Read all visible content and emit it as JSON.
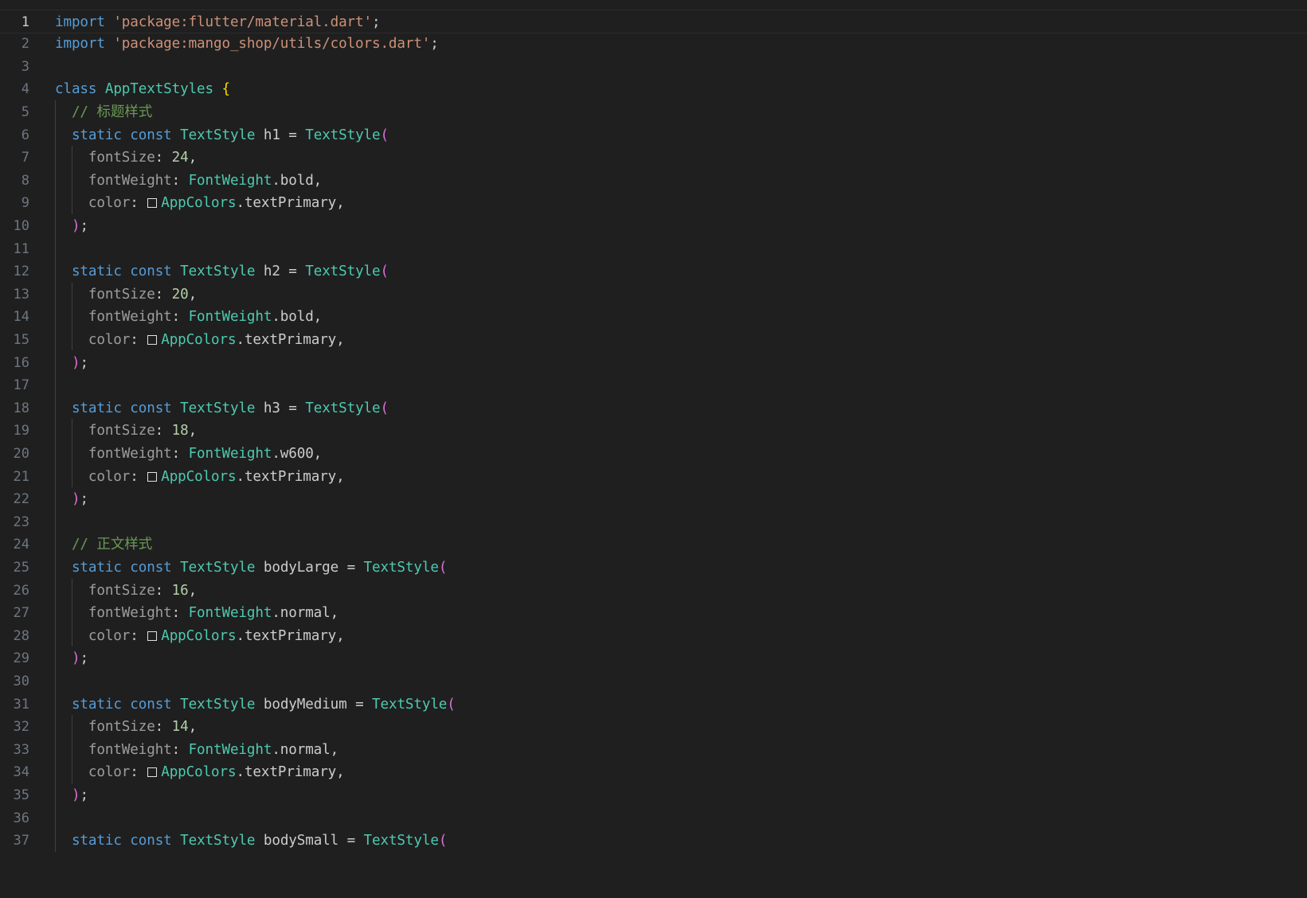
{
  "editor": {
    "language": "dart",
    "active_line": 1,
    "swatch_color": "#1f1f1f",
    "lines": [
      {
        "n": "1",
        "tokens": [
          {
            "t": "import",
            "c": "kw"
          },
          {
            "t": " ",
            "c": "pl"
          },
          {
            "t": "'package:flutter/material.dart'",
            "c": "str"
          },
          {
            "t": ";",
            "c": "pl"
          }
        ]
      },
      {
        "n": "2",
        "tokens": [
          {
            "t": "import",
            "c": "kw"
          },
          {
            "t": " ",
            "c": "pl"
          },
          {
            "t": "'package:mango_shop/utils/colors.dart'",
            "c": "str"
          },
          {
            "t": ";",
            "c": "pl"
          }
        ]
      },
      {
        "n": "3",
        "tokens": []
      },
      {
        "n": "4",
        "tokens": [
          {
            "t": "class",
            "c": "kw"
          },
          {
            "t": " ",
            "c": "pl"
          },
          {
            "t": "AppTextStyles",
            "c": "type"
          },
          {
            "t": " ",
            "c": "pl"
          },
          {
            "t": "{",
            "c": "br1"
          }
        ]
      },
      {
        "n": "5",
        "tokens": [
          {
            "t": "  // 标题样式",
            "c": "com"
          }
        ]
      },
      {
        "n": "6",
        "tokens": [
          {
            "t": "  ",
            "c": "pl"
          },
          {
            "t": "static",
            "c": "kw"
          },
          {
            "t": " ",
            "c": "pl"
          },
          {
            "t": "const",
            "c": "kw"
          },
          {
            "t": " ",
            "c": "pl"
          },
          {
            "t": "TextStyle",
            "c": "type"
          },
          {
            "t": " h1 = ",
            "c": "pl"
          },
          {
            "t": "TextStyle",
            "c": "type"
          },
          {
            "t": "(",
            "c": "br2"
          }
        ]
      },
      {
        "n": "7",
        "tokens": [
          {
            "t": "    ",
            "c": "pl"
          },
          {
            "t": "fontSize",
            "c": "param"
          },
          {
            "t": ": ",
            "c": "pl"
          },
          {
            "t": "24",
            "c": "num"
          },
          {
            "t": ",",
            "c": "pl"
          }
        ]
      },
      {
        "n": "8",
        "tokens": [
          {
            "t": "    ",
            "c": "pl"
          },
          {
            "t": "fontWeight",
            "c": "param"
          },
          {
            "t": ": ",
            "c": "pl"
          },
          {
            "t": "FontWeight",
            "c": "type"
          },
          {
            "t": ".bold,",
            "c": "pl"
          }
        ]
      },
      {
        "n": "9",
        "tokens": [
          {
            "t": "    ",
            "c": "pl"
          },
          {
            "t": "color",
            "c": "param"
          },
          {
            "t": ": ",
            "c": "pl"
          },
          {
            "t": "",
            "c": "swatch"
          },
          {
            "t": "AppColors",
            "c": "type"
          },
          {
            "t": ".textPrimary,",
            "c": "pl"
          }
        ]
      },
      {
        "n": "10",
        "tokens": [
          {
            "t": "  ",
            "c": "pl"
          },
          {
            "t": ")",
            "c": "br2"
          },
          {
            "t": ";",
            "c": "pl"
          }
        ]
      },
      {
        "n": "11",
        "tokens": []
      },
      {
        "n": "12",
        "tokens": [
          {
            "t": "  ",
            "c": "pl"
          },
          {
            "t": "static",
            "c": "kw"
          },
          {
            "t": " ",
            "c": "pl"
          },
          {
            "t": "const",
            "c": "kw"
          },
          {
            "t": " ",
            "c": "pl"
          },
          {
            "t": "TextStyle",
            "c": "type"
          },
          {
            "t": " h2 = ",
            "c": "pl"
          },
          {
            "t": "TextStyle",
            "c": "type"
          },
          {
            "t": "(",
            "c": "br2"
          }
        ]
      },
      {
        "n": "13",
        "tokens": [
          {
            "t": "    ",
            "c": "pl"
          },
          {
            "t": "fontSize",
            "c": "param"
          },
          {
            "t": ": ",
            "c": "pl"
          },
          {
            "t": "20",
            "c": "num"
          },
          {
            "t": ",",
            "c": "pl"
          }
        ]
      },
      {
        "n": "14",
        "tokens": [
          {
            "t": "    ",
            "c": "pl"
          },
          {
            "t": "fontWeight",
            "c": "param"
          },
          {
            "t": ": ",
            "c": "pl"
          },
          {
            "t": "FontWeight",
            "c": "type"
          },
          {
            "t": ".bold,",
            "c": "pl"
          }
        ]
      },
      {
        "n": "15",
        "tokens": [
          {
            "t": "    ",
            "c": "pl"
          },
          {
            "t": "color",
            "c": "param"
          },
          {
            "t": ": ",
            "c": "pl"
          },
          {
            "t": "",
            "c": "swatch"
          },
          {
            "t": "AppColors",
            "c": "type"
          },
          {
            "t": ".textPrimary,",
            "c": "pl"
          }
        ]
      },
      {
        "n": "16",
        "tokens": [
          {
            "t": "  ",
            "c": "pl"
          },
          {
            "t": ")",
            "c": "br2"
          },
          {
            "t": ";",
            "c": "pl"
          }
        ]
      },
      {
        "n": "17",
        "tokens": []
      },
      {
        "n": "18",
        "tokens": [
          {
            "t": "  ",
            "c": "pl"
          },
          {
            "t": "static",
            "c": "kw"
          },
          {
            "t": " ",
            "c": "pl"
          },
          {
            "t": "const",
            "c": "kw"
          },
          {
            "t": " ",
            "c": "pl"
          },
          {
            "t": "TextStyle",
            "c": "type"
          },
          {
            "t": " h3 = ",
            "c": "pl"
          },
          {
            "t": "TextStyle",
            "c": "type"
          },
          {
            "t": "(",
            "c": "br2"
          }
        ]
      },
      {
        "n": "19",
        "tokens": [
          {
            "t": "    ",
            "c": "pl"
          },
          {
            "t": "fontSize",
            "c": "param"
          },
          {
            "t": ": ",
            "c": "pl"
          },
          {
            "t": "18",
            "c": "num"
          },
          {
            "t": ",",
            "c": "pl"
          }
        ]
      },
      {
        "n": "20",
        "tokens": [
          {
            "t": "    ",
            "c": "pl"
          },
          {
            "t": "fontWeight",
            "c": "param"
          },
          {
            "t": ": ",
            "c": "pl"
          },
          {
            "t": "FontWeight",
            "c": "type"
          },
          {
            "t": ".w600,",
            "c": "pl"
          }
        ]
      },
      {
        "n": "21",
        "tokens": [
          {
            "t": "    ",
            "c": "pl"
          },
          {
            "t": "color",
            "c": "param"
          },
          {
            "t": ": ",
            "c": "pl"
          },
          {
            "t": "",
            "c": "swatch"
          },
          {
            "t": "AppColors",
            "c": "type"
          },
          {
            "t": ".textPrimary,",
            "c": "pl"
          }
        ]
      },
      {
        "n": "22",
        "tokens": [
          {
            "t": "  ",
            "c": "pl"
          },
          {
            "t": ")",
            "c": "br2"
          },
          {
            "t": ";",
            "c": "pl"
          }
        ]
      },
      {
        "n": "23",
        "tokens": []
      },
      {
        "n": "24",
        "tokens": [
          {
            "t": "  // 正文样式",
            "c": "com"
          }
        ]
      },
      {
        "n": "25",
        "tokens": [
          {
            "t": "  ",
            "c": "pl"
          },
          {
            "t": "static",
            "c": "kw"
          },
          {
            "t": " ",
            "c": "pl"
          },
          {
            "t": "const",
            "c": "kw"
          },
          {
            "t": " ",
            "c": "pl"
          },
          {
            "t": "TextStyle",
            "c": "type"
          },
          {
            "t": " bodyLarge = ",
            "c": "pl"
          },
          {
            "t": "TextStyle",
            "c": "type"
          },
          {
            "t": "(",
            "c": "br2"
          }
        ]
      },
      {
        "n": "26",
        "tokens": [
          {
            "t": "    ",
            "c": "pl"
          },
          {
            "t": "fontSize",
            "c": "param"
          },
          {
            "t": ": ",
            "c": "pl"
          },
          {
            "t": "16",
            "c": "num"
          },
          {
            "t": ",",
            "c": "pl"
          }
        ]
      },
      {
        "n": "27",
        "tokens": [
          {
            "t": "    ",
            "c": "pl"
          },
          {
            "t": "fontWeight",
            "c": "param"
          },
          {
            "t": ": ",
            "c": "pl"
          },
          {
            "t": "FontWeight",
            "c": "type"
          },
          {
            "t": ".normal,",
            "c": "pl"
          }
        ]
      },
      {
        "n": "28",
        "tokens": [
          {
            "t": "    ",
            "c": "pl"
          },
          {
            "t": "color",
            "c": "param"
          },
          {
            "t": ": ",
            "c": "pl"
          },
          {
            "t": "",
            "c": "swatch"
          },
          {
            "t": "AppColors",
            "c": "type"
          },
          {
            "t": ".textPrimary,",
            "c": "pl"
          }
        ]
      },
      {
        "n": "29",
        "tokens": [
          {
            "t": "  ",
            "c": "pl"
          },
          {
            "t": ")",
            "c": "br2"
          },
          {
            "t": ";",
            "c": "pl"
          }
        ]
      },
      {
        "n": "30",
        "tokens": []
      },
      {
        "n": "31",
        "tokens": [
          {
            "t": "  ",
            "c": "pl"
          },
          {
            "t": "static",
            "c": "kw"
          },
          {
            "t": " ",
            "c": "pl"
          },
          {
            "t": "const",
            "c": "kw"
          },
          {
            "t": " ",
            "c": "pl"
          },
          {
            "t": "TextStyle",
            "c": "type"
          },
          {
            "t": " bodyMedium = ",
            "c": "pl"
          },
          {
            "t": "TextStyle",
            "c": "type"
          },
          {
            "t": "(",
            "c": "br2"
          }
        ]
      },
      {
        "n": "32",
        "tokens": [
          {
            "t": "    ",
            "c": "pl"
          },
          {
            "t": "fontSize",
            "c": "param"
          },
          {
            "t": ": ",
            "c": "pl"
          },
          {
            "t": "14",
            "c": "num"
          },
          {
            "t": ",",
            "c": "pl"
          }
        ]
      },
      {
        "n": "33",
        "tokens": [
          {
            "t": "    ",
            "c": "pl"
          },
          {
            "t": "fontWeight",
            "c": "param"
          },
          {
            "t": ": ",
            "c": "pl"
          },
          {
            "t": "FontWeight",
            "c": "type"
          },
          {
            "t": ".normal,",
            "c": "pl"
          }
        ]
      },
      {
        "n": "34",
        "tokens": [
          {
            "t": "    ",
            "c": "pl"
          },
          {
            "t": "color",
            "c": "param"
          },
          {
            "t": ": ",
            "c": "pl"
          },
          {
            "t": "",
            "c": "swatch"
          },
          {
            "t": "AppColors",
            "c": "type"
          },
          {
            "t": ".textPrimary,",
            "c": "pl"
          }
        ]
      },
      {
        "n": "35",
        "tokens": [
          {
            "t": "  ",
            "c": "pl"
          },
          {
            "t": ")",
            "c": "br2"
          },
          {
            "t": ";",
            "c": "pl"
          }
        ]
      },
      {
        "n": "36",
        "tokens": []
      },
      {
        "n": "37",
        "tokens": [
          {
            "t": "  ",
            "c": "pl"
          },
          {
            "t": "static",
            "c": "kw"
          },
          {
            "t": " ",
            "c": "pl"
          },
          {
            "t": "const",
            "c": "kw"
          },
          {
            "t": " ",
            "c": "pl"
          },
          {
            "t": "TextStyle",
            "c": "type"
          },
          {
            "t": " bodySmall = ",
            "c": "pl"
          },
          {
            "t": "TextStyle",
            "c": "type"
          },
          {
            "t": "(",
            "c": "br2"
          }
        ]
      }
    ]
  }
}
